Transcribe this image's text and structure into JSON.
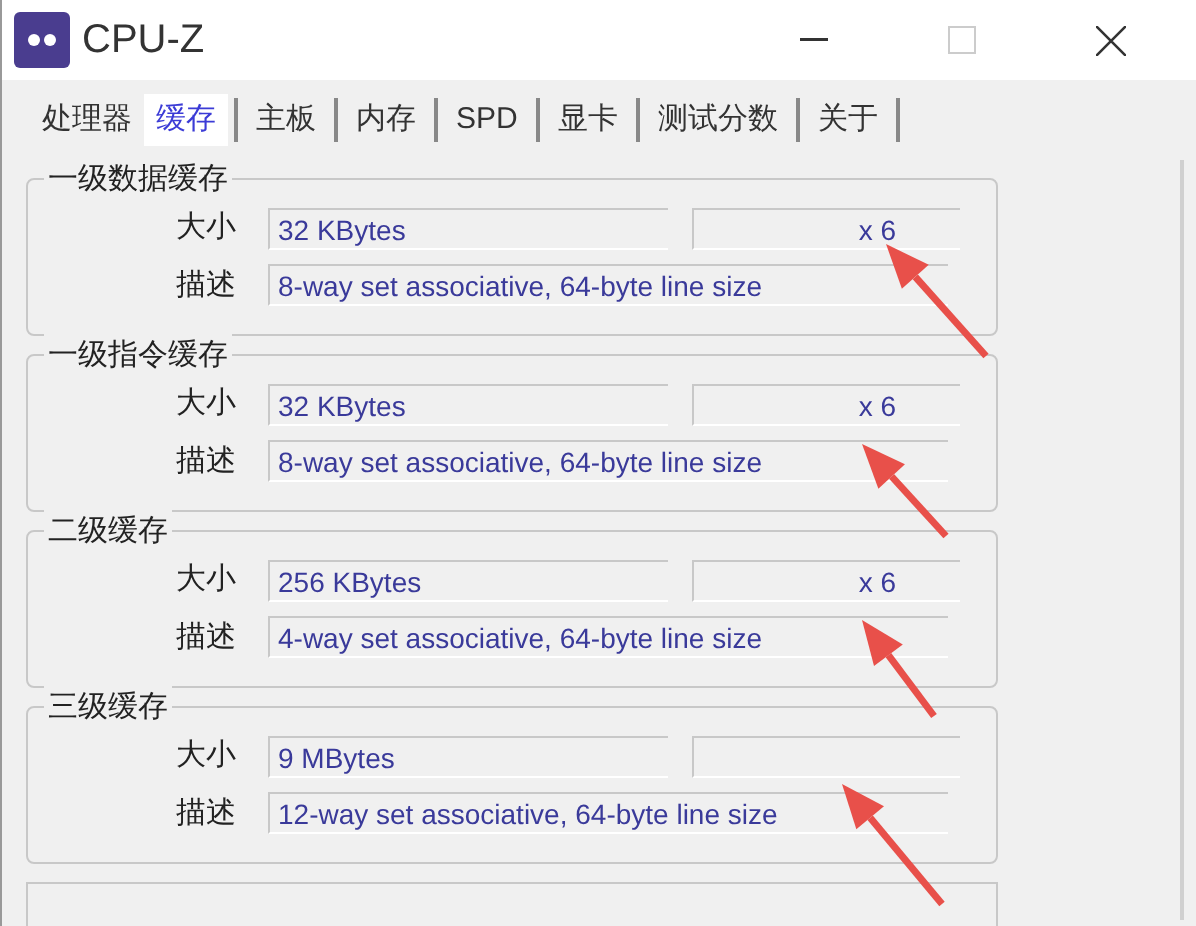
{
  "window": {
    "title": "CPU-Z"
  },
  "tabs": [
    {
      "label": "处理器",
      "selected": false
    },
    {
      "label": "缓存",
      "selected": true
    },
    {
      "label": "主板",
      "selected": false
    },
    {
      "label": "内存",
      "selected": false
    },
    {
      "label": "SPD",
      "selected": false
    },
    {
      "label": "显卡",
      "selected": false
    },
    {
      "label": "测试分数",
      "selected": false
    },
    {
      "label": "关于",
      "selected": false
    }
  ],
  "groups": [
    {
      "title": "一级数据缓存",
      "size_label": "大小",
      "size": "32 KBytes",
      "count": "x 6",
      "desc_label": "描述",
      "desc": "8-way set associative, 64-byte line size"
    },
    {
      "title": "一级指令缓存",
      "size_label": "大小",
      "size": "32 KBytes",
      "count": "x 6",
      "desc_label": "描述",
      "desc": "8-way set associative, 64-byte line size"
    },
    {
      "title": "二级缓存",
      "size_label": "大小",
      "size": "256 KBytes",
      "count": "x 6",
      "desc_label": "描述",
      "desc": "4-way set associative, 64-byte line size"
    },
    {
      "title": "三级缓存",
      "size_label": "大小",
      "size": "9 MBytes",
      "desc_label": "描述",
      "desc": "12-way set associative, 64-byte line size"
    }
  ]
}
